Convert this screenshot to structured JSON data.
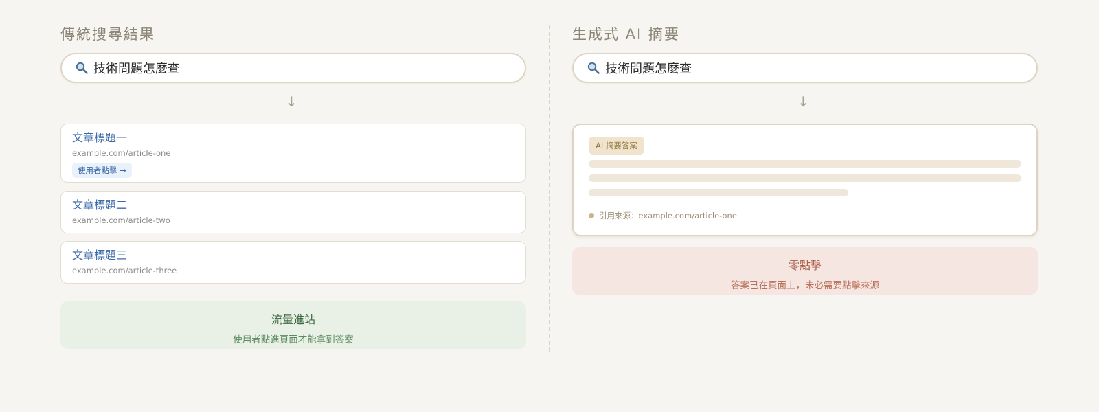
{
  "left_panel": {
    "title": "傳統搜尋結果",
    "search_query": "技術問題怎麼查",
    "arrow": "↓",
    "results": [
      {
        "title": "文章標題一",
        "url": "example.com/article-one",
        "badge": "使用者點擊 →"
      },
      {
        "title": "文章標題二",
        "url": "example.com/article-two"
      },
      {
        "title": "文章標題三",
        "url": "example.com/article-three"
      }
    ],
    "note": {
      "title": "流量進站",
      "subtitle": "使用者點進頁面才能拿到答案"
    }
  },
  "right_panel": {
    "title": "生成式 AI 摘要",
    "search_query": "技術問題怎麼查",
    "arrow": "↓",
    "ai_card": {
      "badge": "AI 摘要答案",
      "source": "引用來源：example.com/article-one"
    },
    "note": {
      "title": "零點擊",
      "subtitle": "答案已在頁面上，未必需要點擊來源"
    }
  },
  "colors": {
    "background": "#f7f5f1",
    "link_blue": "#3c6aa9",
    "green_box": "#e9f1e7",
    "red_box": "#f6e6e2",
    "ai_badge": "#f1e4cf"
  },
  "icons": {
    "search": "magnifier-icon"
  }
}
